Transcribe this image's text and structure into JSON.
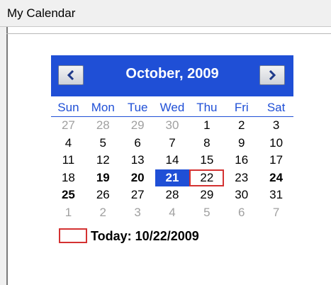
{
  "panel": {
    "title": "My Calendar"
  },
  "calendar": {
    "month_title": "October, 2009",
    "prev_icon": "chevron-left-icon",
    "next_icon": "chevron-right-icon",
    "days_of_week": [
      "Sun",
      "Mon",
      "Tue",
      "Wed",
      "Thu",
      "Fri",
      "Sat"
    ],
    "weeks": [
      [
        {
          "d": "27",
          "o": true
        },
        {
          "d": "28",
          "o": true
        },
        {
          "d": "29",
          "o": true
        },
        {
          "d": "30",
          "o": true
        },
        {
          "d": "1"
        },
        {
          "d": "2"
        },
        {
          "d": "3"
        }
      ],
      [
        {
          "d": "4"
        },
        {
          "d": "5"
        },
        {
          "d": "6"
        },
        {
          "d": "7"
        },
        {
          "d": "8"
        },
        {
          "d": "9"
        },
        {
          "d": "10"
        }
      ],
      [
        {
          "d": "11"
        },
        {
          "d": "12"
        },
        {
          "d": "13"
        },
        {
          "d": "14"
        },
        {
          "d": "15"
        },
        {
          "d": "16"
        },
        {
          "d": "17"
        }
      ],
      [
        {
          "d": "18"
        },
        {
          "d": "19",
          "b": true
        },
        {
          "d": "20",
          "b": true
        },
        {
          "d": "21",
          "sel": true
        },
        {
          "d": "22",
          "today": true
        },
        {
          "d": "23"
        },
        {
          "d": "24",
          "b": true
        }
      ],
      [
        {
          "d": "25",
          "b": true
        },
        {
          "d": "26"
        },
        {
          "d": "27"
        },
        {
          "d": "28"
        },
        {
          "d": "29"
        },
        {
          "d": "30"
        },
        {
          "d": "31"
        }
      ],
      [
        {
          "d": "1",
          "o": true
        },
        {
          "d": "2",
          "o": true
        },
        {
          "d": "3",
          "o": true
        },
        {
          "d": "4",
          "o": true
        },
        {
          "d": "5",
          "o": true
        },
        {
          "d": "6",
          "o": true
        },
        {
          "d": "7",
          "o": true
        }
      ]
    ],
    "today_label": "Today: 10/22/2009"
  },
  "colors": {
    "header_bg": "#1f4fd6",
    "selected_bg": "#1f4fd6",
    "today_border": "#d43232",
    "other_month_text": "#a0a0a0"
  }
}
